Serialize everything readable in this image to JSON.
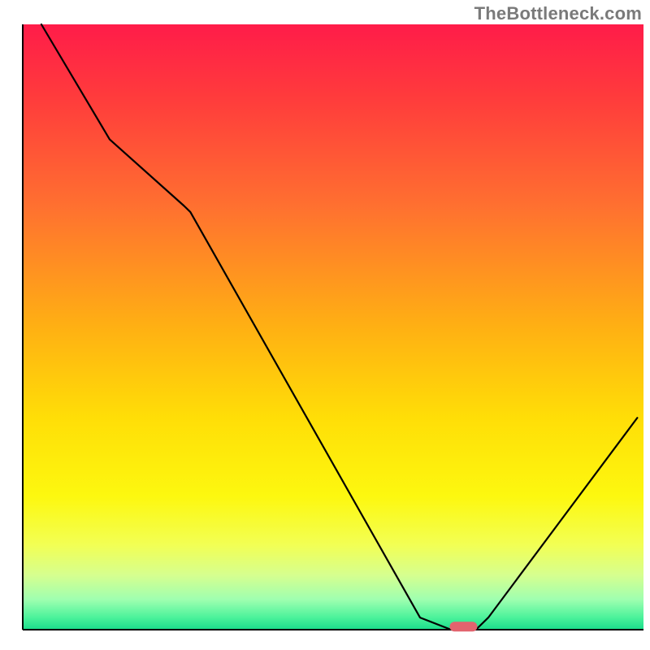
{
  "watermark": "TheBottleneck.com",
  "chart_data": {
    "type": "line",
    "title": "",
    "xlabel": "",
    "ylabel": "",
    "xlim": [
      0,
      100
    ],
    "ylim": [
      0,
      100
    ],
    "grid": false,
    "legend": false,
    "series": [
      {
        "name": "bottleneck-curve",
        "x": [
          3,
          14,
          26,
          27,
          64,
          69,
          73,
          75,
          99
        ],
        "y": [
          100,
          81,
          70,
          69,
          2,
          0,
          0,
          2,
          35
        ]
      }
    ],
    "marker": {
      "name": "optimal-point",
      "x": 71,
      "y": 0.5,
      "color": "#e2636e"
    },
    "background_gradient": {
      "stops": [
        {
          "offset": 0,
          "color": "#ff1c49"
        },
        {
          "offset": 12,
          "color": "#ff3b3c"
        },
        {
          "offset": 30,
          "color": "#ff7030"
        },
        {
          "offset": 50,
          "color": "#ffb013"
        },
        {
          "offset": 65,
          "color": "#ffde07"
        },
        {
          "offset": 78,
          "color": "#fdf80f"
        },
        {
          "offset": 86,
          "color": "#f2ff54"
        },
        {
          "offset": 91,
          "color": "#d6ff8f"
        },
        {
          "offset": 95,
          "color": "#9fffb0"
        },
        {
          "offset": 98,
          "color": "#4bf29b"
        },
        {
          "offset": 100,
          "color": "#19dd8b"
        }
      ]
    }
  }
}
